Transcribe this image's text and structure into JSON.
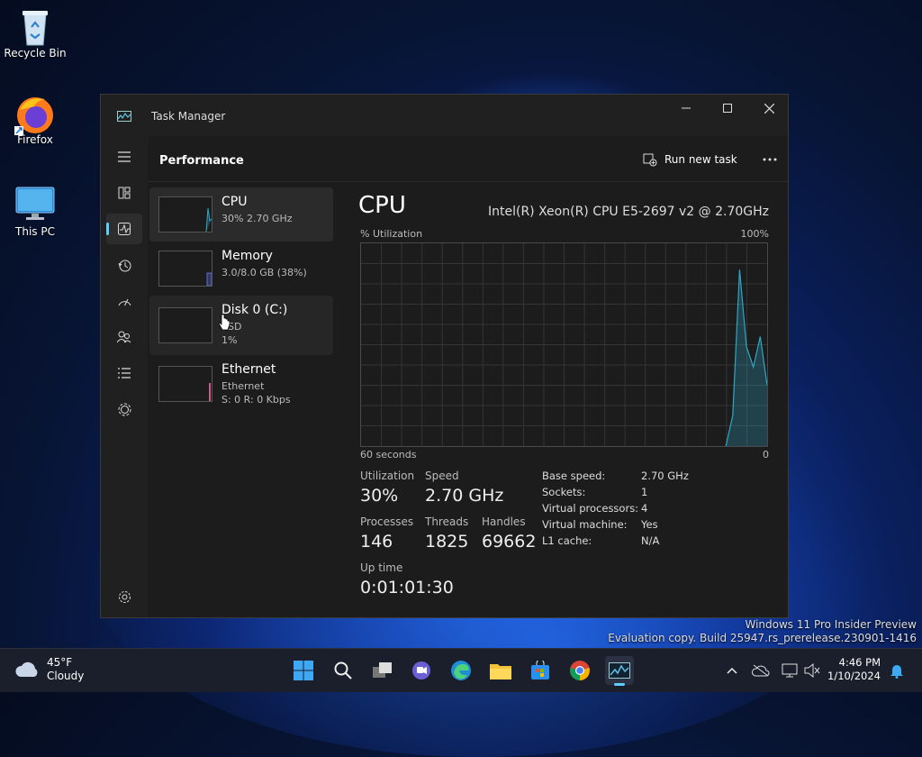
{
  "desktop": {
    "icons": [
      {
        "label": "Recycle Bin"
      },
      {
        "label": "Firefox"
      },
      {
        "label": "This PC"
      }
    ],
    "watermark": {
      "line1": "Windows 11 Pro Insider Preview",
      "line2": "Evaluation copy. Build 25947.rs_prerelease.230901-1416"
    }
  },
  "window": {
    "title": "Task Manager",
    "header": {
      "title": "Performance",
      "run_task_label": "Run new task"
    },
    "nav_icons": [
      "hamburger-icon",
      "processes-icon",
      "performance-icon",
      "app-history-icon",
      "startup-icon",
      "users-icon",
      "details-icon",
      "services-icon",
      "settings-icon"
    ],
    "devices": [
      {
        "name": "CPU",
        "sub1": "30% 2.70 GHz",
        "sub2": ""
      },
      {
        "name": "Memory",
        "sub1": "3.0/8.0 GB (38%)",
        "sub2": ""
      },
      {
        "name": "Disk 0 (C:)",
        "sub1": "SSD",
        "sub2": "1%"
      },
      {
        "name": "Ethernet",
        "sub1": "Ethernet",
        "sub2": "S: 0 R: 0 Kbps"
      }
    ],
    "cpu": {
      "title": "CPU",
      "model": "Intel(R) Xeon(R) CPU E5-2697 v2 @ 2.70GHz",
      "graph_label": "% Utilization",
      "graph_max": "100%",
      "graph_time": "60 seconds",
      "graph_min": "0",
      "utilization_graph": [
        0,
        0,
        0,
        0,
        0,
        0,
        0,
        0,
        0,
        0,
        0,
        0,
        0,
        0,
        0,
        0,
        0,
        0,
        0,
        0,
        0,
        0,
        0,
        0,
        0,
        0,
        0,
        0,
        0,
        0,
        0,
        0,
        0,
        0,
        0,
        0,
        0,
        0,
        0,
        0,
        0,
        0,
        0,
        0,
        0,
        0,
        0,
        0,
        0,
        0,
        0,
        0,
        0,
        0,
        15,
        87,
        49,
        39,
        54,
        30
      ],
      "stats": {
        "utilization_label": "Utilization",
        "utilization": "30%",
        "speed_label": "Speed",
        "speed": "2.70 GHz",
        "processes_label": "Processes",
        "processes": "146",
        "threads_label": "Threads",
        "threads": "1825",
        "handles_label": "Handles",
        "handles": "69662",
        "uptime_label": "Up time",
        "uptime": "0:01:01:30"
      },
      "details": [
        {
          "k": "Base speed:",
          "v": "2.70 GHz"
        },
        {
          "k": "Sockets:",
          "v": "1"
        },
        {
          "k": "Virtual processors:",
          "v": "4"
        },
        {
          "k": "Virtual machine:",
          "v": "Yes"
        },
        {
          "k": "L1 cache:",
          "v": "N/A"
        }
      ]
    }
  },
  "taskbar": {
    "weather": {
      "temp": "45°F",
      "cond": "Cloudy"
    },
    "time": "4:46 PM",
    "date": "1/10/2024"
  },
  "colors": {
    "accent": "#60cdff",
    "cpu_line": "#2ea7c7",
    "memory_line": "#5b6cd6",
    "ethernet_line": "#d05a8a"
  }
}
